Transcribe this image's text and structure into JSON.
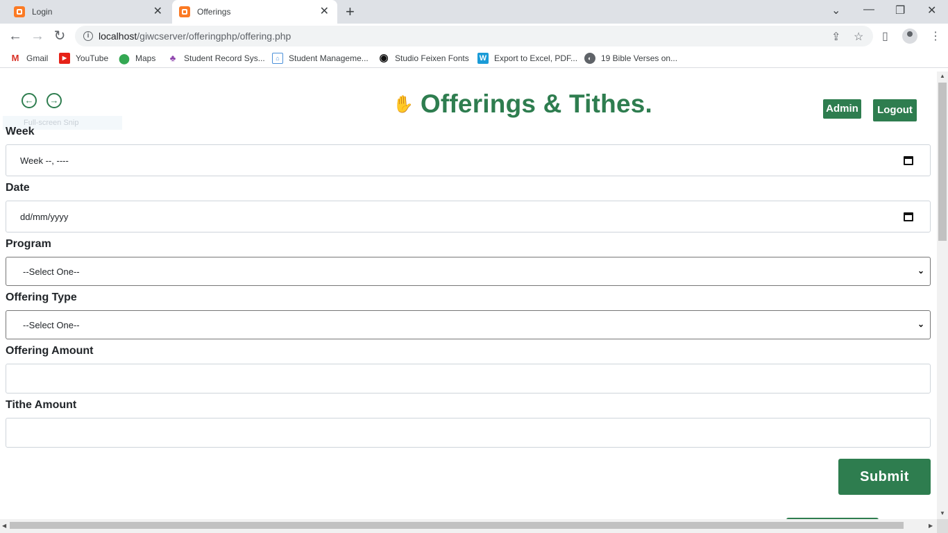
{
  "browser": {
    "tabs": [
      {
        "title": "Login"
      },
      {
        "title": "Offerings"
      }
    ],
    "url_host": "localhost",
    "url_path": "/giwcserver/offeringphp/offering.php",
    "bookmarks": [
      {
        "label": "Gmail",
        "icon": "gmail-icon"
      },
      {
        "label": "YouTube",
        "icon": "youtube-icon"
      },
      {
        "label": "Maps",
        "icon": "maps-icon"
      },
      {
        "label": "Student Record Sys...",
        "icon": "student-record-icon"
      },
      {
        "label": "Student Manageme...",
        "icon": "student-management-icon"
      },
      {
        "label": "Studio Feixen Fonts",
        "icon": "target-icon"
      },
      {
        "label": "Export to Excel, PDF...",
        "icon": "w-icon"
      },
      {
        "label": "19 Bible Verses on...",
        "icon": "globe-icon"
      }
    ]
  },
  "header": {
    "title": "Offerings & Tithes.",
    "admin_label": "Admin",
    "logout_label": "Logout",
    "snip_label": "Full-screen Snip"
  },
  "form": {
    "week_label": "Week",
    "week_value": "Week --, ----",
    "date_label": "Date",
    "date_value": "dd/mm/yyyy",
    "program_label": "Program",
    "program_value": "--Select One--",
    "offering_type_label": "Offering Type",
    "offering_type_value": "--Select One--",
    "offering_amount_label": "Offering Amount",
    "offering_amount_value": "",
    "tithe_amount_label": "Tithe Amount",
    "tithe_amount_value": "",
    "submit_label": "Submit"
  },
  "colors": {
    "accent": "#2e7d4f"
  }
}
